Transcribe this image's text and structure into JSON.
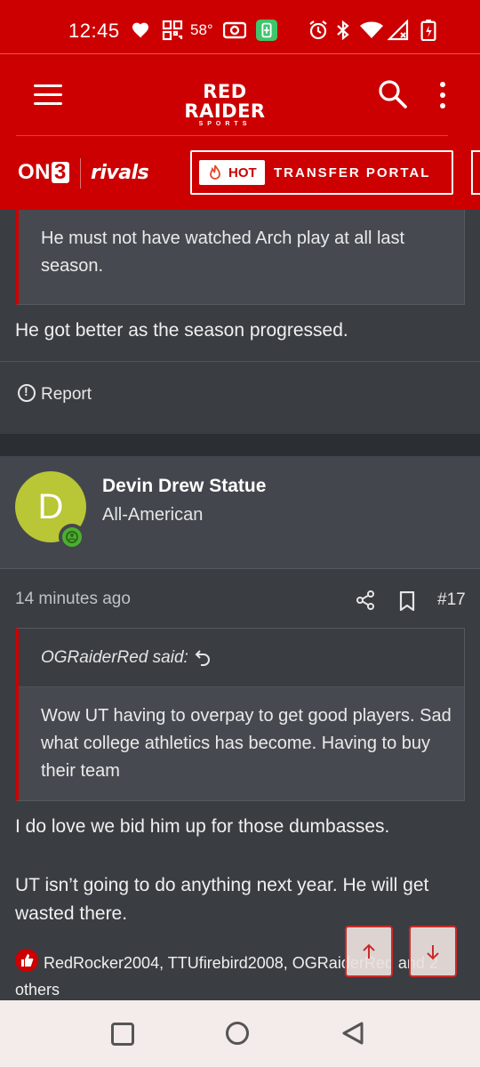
{
  "status_bar": {
    "time": "12:45",
    "temperature": "58°",
    "icons": [
      "heart-icon",
      "grid-app-icon",
      "radio-icon",
      "battery-saver-icon",
      "alarm-icon",
      "bluetooth-icon",
      "wifi-icon",
      "signal-icon",
      "battery-charging-icon"
    ]
  },
  "header": {
    "logo_line1": "RED RAIDER",
    "logo_line2": "SPORTS",
    "on3_text": "ON",
    "on3_num": "3",
    "rivals_text": "rivals",
    "hot_label": "HOT",
    "transfer_label": "TRANSFER PORTAL"
  },
  "post1": {
    "quote_text": "He must not have watched Arch play at all last season.",
    "body": "He got better as the season progressed.",
    "report_label": "Report"
  },
  "post2": {
    "avatar_letter": "D",
    "username": "Devin Drew Statue",
    "role": "All-American",
    "timestamp": "14 minutes ago",
    "post_number": "#17",
    "quote_author": "OGRaiderRed said:",
    "quote_text": "Wow UT having to overpay to get good players. Sad what college athletics has become. Having to buy their team",
    "body_p1": "I do love we bid him up for those dumbasses.",
    "body_p2": "UT isn’t going to do anything next year. He will get wasted there.",
    "likers": "RedRocker2004, TTUfirebird2008, OGRaiderRed and 2 others"
  },
  "colors": {
    "brand_red": "#cc0000",
    "background": "#3a3d42",
    "avatar": "#b9c635",
    "online": "#4caf2f"
  }
}
